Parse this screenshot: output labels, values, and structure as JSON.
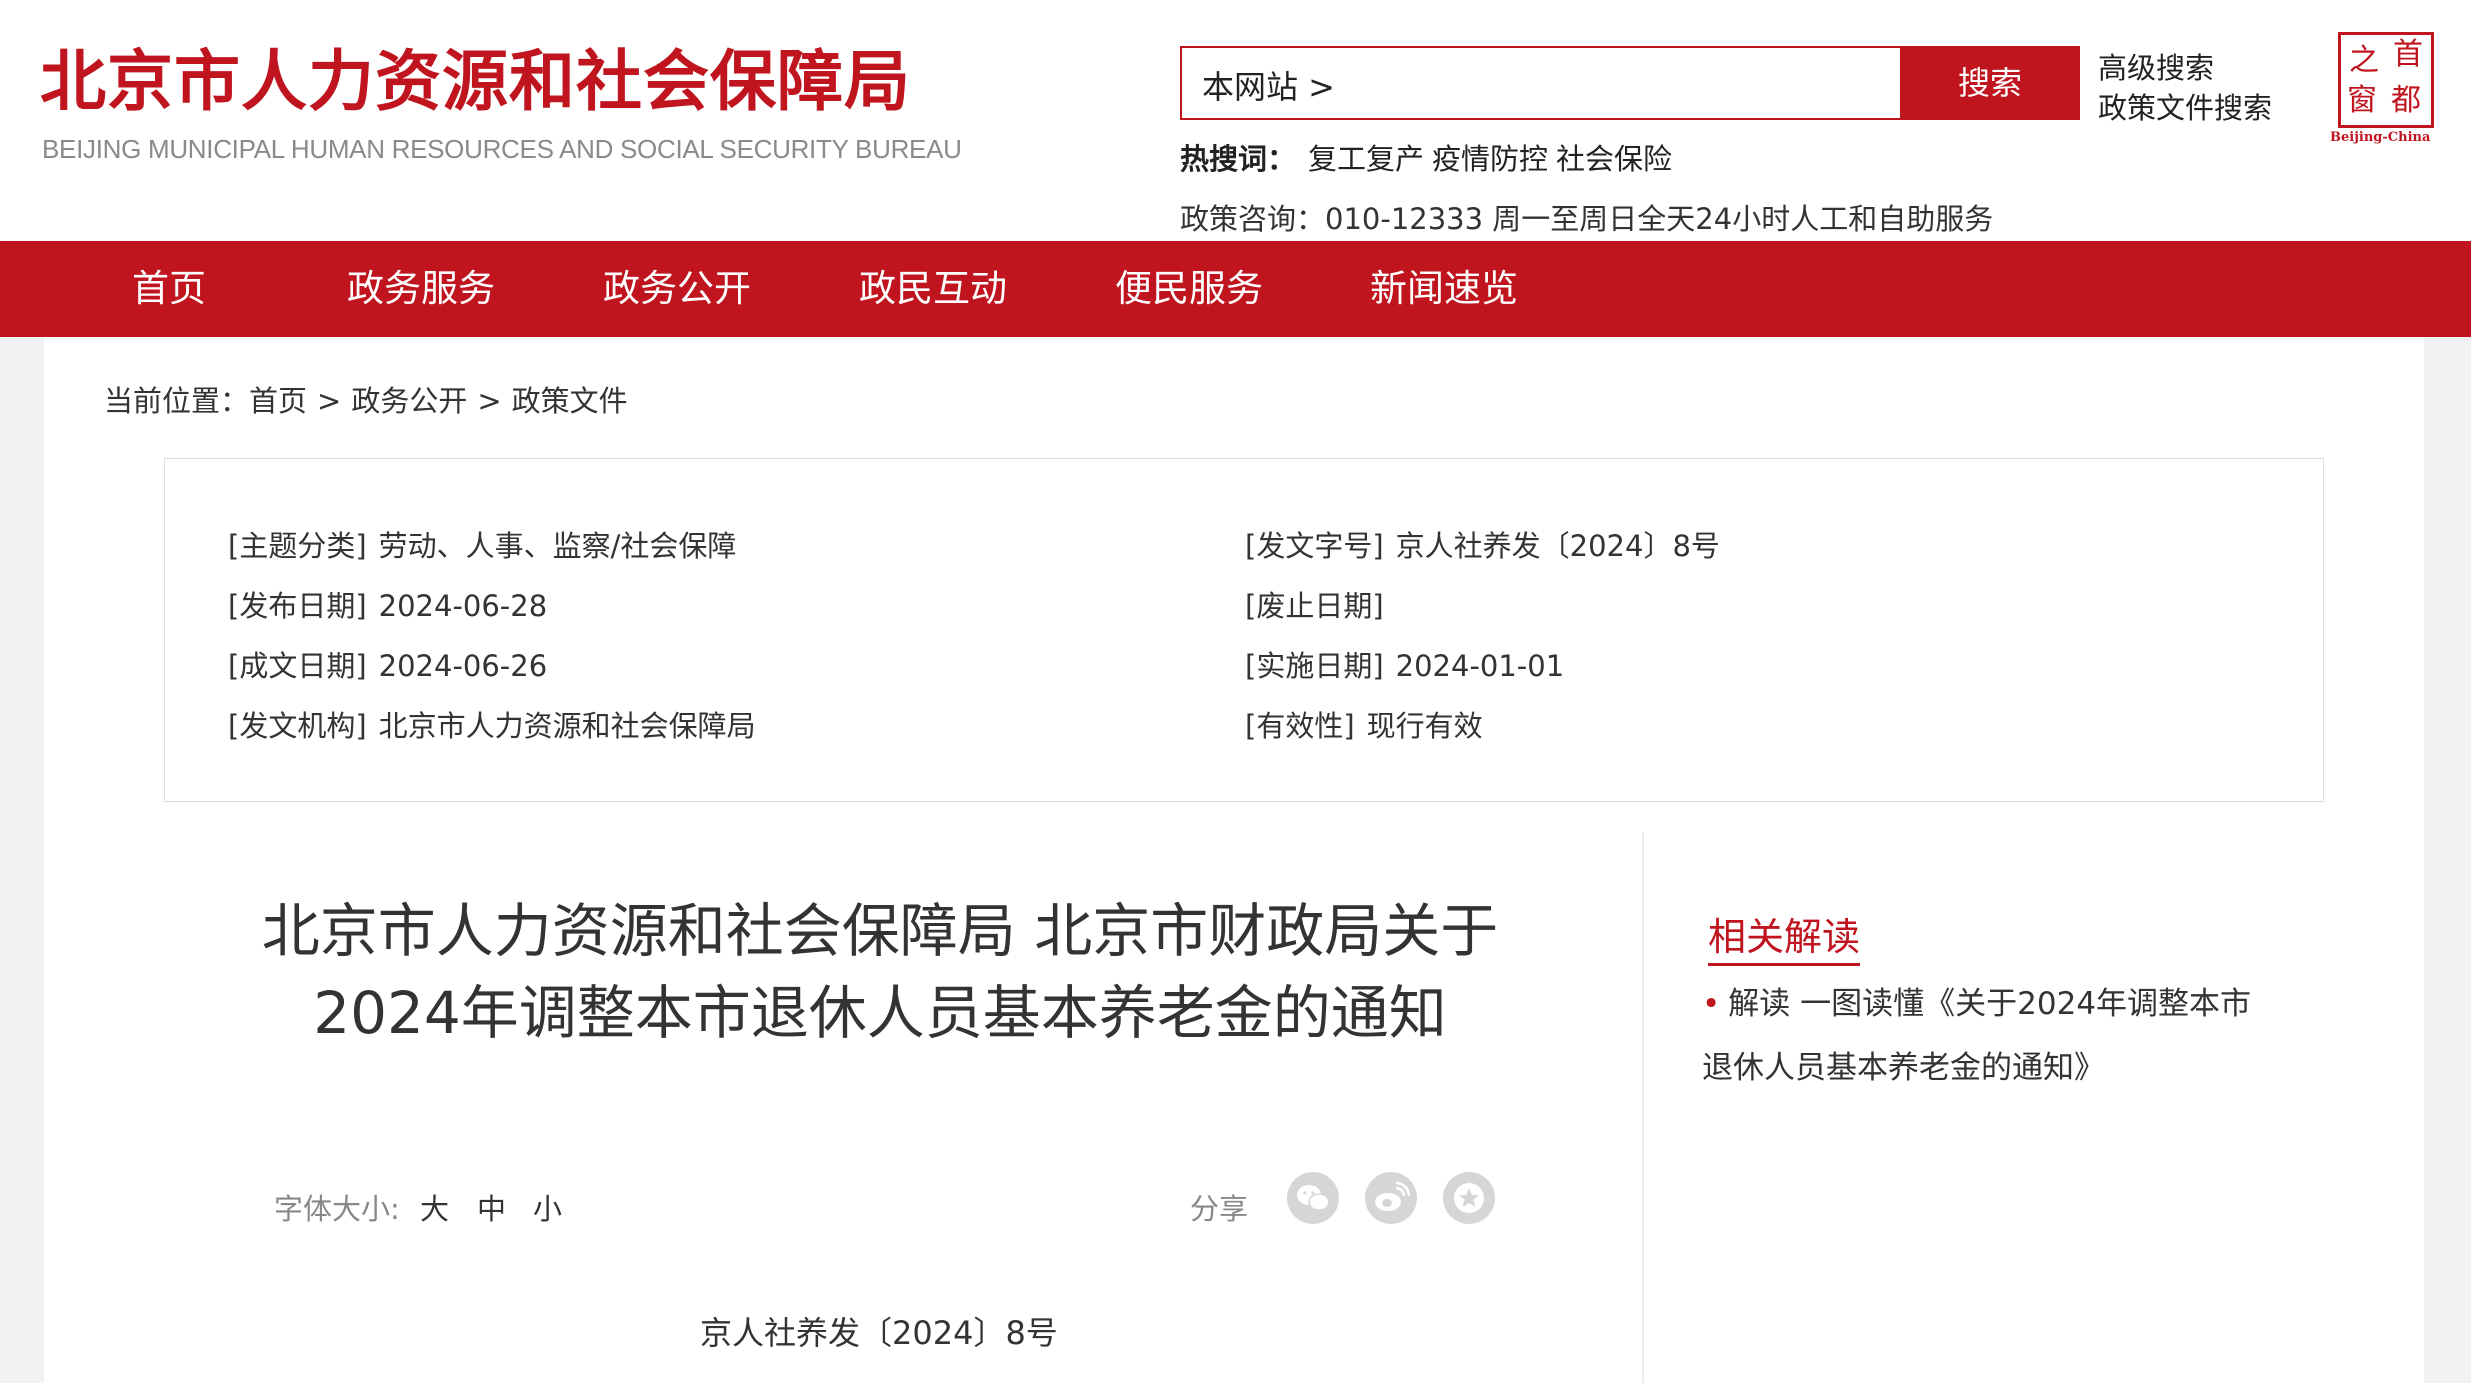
{
  "header": {
    "logo_cn": "北京市人力资源和社会保障局",
    "logo_en": "BEIJING MUNICIPAL HUMAN RESOURCES AND SOCIAL SECURITY BUREAU",
    "search_scope": "本网站 >",
    "search_button": "搜索",
    "advanced_search": "高级搜索",
    "policy_search": "政策文件搜索",
    "hot_label": "热搜词：",
    "hot_words": [
      "复工复产",
      "疫情防控",
      "社会保险"
    ],
    "consult": "政策咨询：010-12333 周一至周日全天24小时人工和自助服务",
    "seal_chars": [
      "之",
      "首",
      "窗",
      "都"
    ],
    "seal_sub": "Beijing-China"
  },
  "nav": {
    "items": [
      "首页",
      "政务服务",
      "政务公开",
      "政民互动",
      "便民服务",
      "新闻速览"
    ]
  },
  "breadcrumb": {
    "label": "当前位置：",
    "items": [
      "首页",
      "政务公开",
      "政策文件"
    ],
    "sep": ">"
  },
  "meta": {
    "topic_key": "[主题分类]",
    "topic_val": "劳动、人事、监察/社会保障",
    "docno_key": "[发文字号]",
    "docno_val": "京人社养发〔2024〕8号",
    "pubdate_key": "[发布日期]",
    "pubdate_val": "2024-06-28",
    "abolish_key": "[废止日期]",
    "abolish_val": "",
    "written_key": "[成文日期]",
    "written_val": "2024-06-26",
    "effect_key": "[实施日期]",
    "effect_val": "2024-01-01",
    "org_key": "[发文机构]",
    "org_val": "北京市人力资源和社会保障局",
    "valid_key": "[有效性]",
    "valid_val": "现行有效"
  },
  "article": {
    "title_line1": "北京市人力资源和社会保障局 北京市财政局关于",
    "title_line2": "2024年调整本市退休人员基本养老金的通知",
    "font_size_label": "字体大小:",
    "font_sizes": [
      "大",
      "中",
      "小"
    ],
    "share_label": "分享",
    "share_icons": [
      "wechat-icon",
      "weibo-icon",
      "favorite-icon"
    ],
    "doc_number": "京人社养发〔2024〕8号"
  },
  "related": {
    "title": "相关解读",
    "items": [
      {
        "prefix": "解读",
        "text": "一图读懂《关于2024年调整本市退休人员基本养老金的通知》"
      }
    ]
  },
  "colors": {
    "brand_red": "#c0151f"
  }
}
